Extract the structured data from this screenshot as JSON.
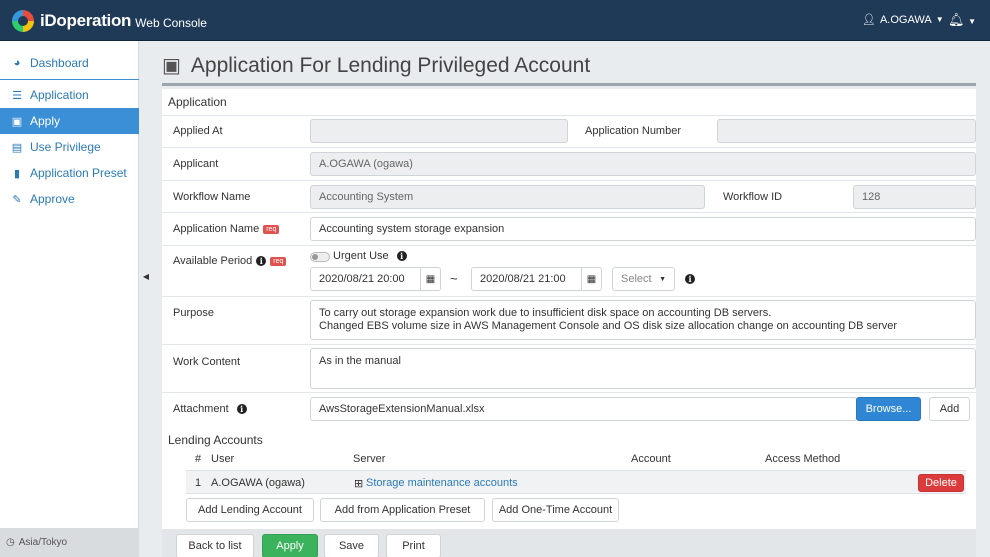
{
  "header": {
    "logo_text": "iDoperation",
    "logo_sub": "Web Console",
    "user": "A.OGAWA"
  },
  "sidebar": {
    "items": [
      {
        "label": "Dashboard",
        "icon": "dashboard-icon"
      },
      {
        "label": "Application",
        "icon": "list-icon"
      },
      {
        "label": "Apply",
        "icon": "inbox-icon",
        "active": true
      },
      {
        "label": "Use Privilege",
        "icon": "laptop-icon"
      },
      {
        "label": "Application Preset",
        "icon": "bookmark-icon"
      },
      {
        "label": "Approve",
        "icon": "edit-icon"
      }
    ],
    "timezone": "Asia/Tokyo"
  },
  "page": {
    "title": "Application For Lending Privileged Account"
  },
  "form": {
    "section": "Application",
    "applied_at_label": "Applied At",
    "applied_at_value": "",
    "app_number_label": "Application Number",
    "app_number_value": "",
    "applicant_label": "Applicant",
    "applicant_value": "A.OGAWA (ogawa)",
    "workflow_name_label": "Workflow Name",
    "workflow_name_value": "Accounting System",
    "workflow_id_label": "Workflow ID",
    "workflow_id_value": "128",
    "app_name_label": "Application Name",
    "req": "req",
    "app_name_value": "Accounting system storage expansion",
    "period_label": "Available Period",
    "urgent_label": "Urgent Use",
    "period_from": "2020/08/21 20:00",
    "period_sep": "~",
    "period_to": "2020/08/21 21:00",
    "select_placeholder": "Select",
    "purpose_label": "Purpose",
    "purpose_value": "To carry out storage expansion work due to insufficient disk space on accounting DB servers.\nChanged EBS volume size in AWS Management Console and OS disk size allocation change on accounting DB server",
    "work_label": "Work Content",
    "work_value": "As in the manual",
    "attach_label": "Attachment",
    "attach_value": "AwsStorageExtensionManual.xlsx",
    "browse": "Browse...",
    "add": "Add"
  },
  "lending": {
    "section": "Lending Accounts",
    "columns": [
      "#",
      "User",
      "Server",
      "Account",
      "Access Method"
    ],
    "rows": [
      {
        "num": "1",
        "user": "A.OGAWA (ogawa)",
        "server": "Storage maintenance accounts",
        "account": "",
        "access": "",
        "action": "Delete"
      }
    ],
    "buttons": [
      "Add Lending Account",
      "Add from Application Preset",
      "Add One-Time Account"
    ]
  },
  "footer": {
    "back": "Back to list",
    "apply": "Apply",
    "save": "Save",
    "print": "Print"
  }
}
